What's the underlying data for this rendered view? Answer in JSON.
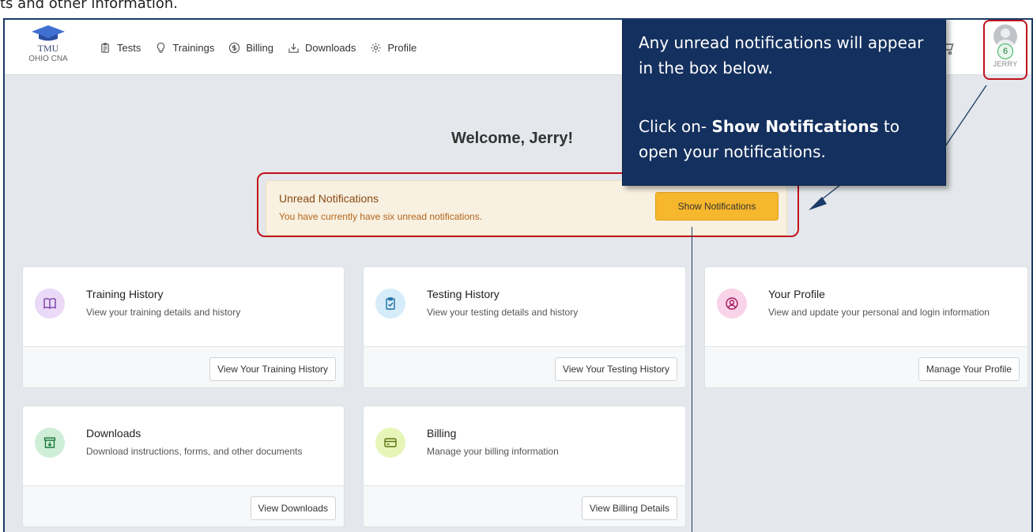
{
  "doc_header": "ts and other information.",
  "app": {
    "logo_line1": "TMU",
    "logo_line2": "OHIO CNA"
  },
  "nav": [
    {
      "label": "Tests",
      "icon": "clipboard-icon"
    },
    {
      "label": "Trainings",
      "icon": "lightbulb-icon"
    },
    {
      "label": "Billing",
      "icon": "dollar-circle-icon"
    },
    {
      "label": "Downloads",
      "icon": "download-tray-icon"
    },
    {
      "label": "Profile",
      "icon": "gear-icon"
    }
  ],
  "user": {
    "badge_count": "6",
    "name": "JERRY"
  },
  "welcome": "Welcome, Jerry!",
  "notifications": {
    "title": "Unread Notifications",
    "text": "You have currently have six unread notifications.",
    "button": "Show Notifications"
  },
  "cards": [
    {
      "title": "Training History",
      "desc": "View your training details and history",
      "button": "View Your Training History",
      "icon": "book-icon",
      "icon_bg": "#ead9f7",
      "icon_color": "#7a3ea6"
    },
    {
      "title": "Testing History",
      "desc": "View your testing details and history",
      "button": "View Your Testing History",
      "icon": "clipboard-check-icon",
      "icon_bg": "#d6ecf9",
      "icon_color": "#1f6fa5"
    },
    {
      "title": "Your Profile",
      "desc": "View and update your personal and login information",
      "button": "Manage Your Profile",
      "icon": "user-circle-icon",
      "icon_bg": "#f9d3e7",
      "icon_color": "#a3195c"
    },
    {
      "title": "Downloads",
      "desc": "Download instructions, forms, and other documents",
      "button": "View Downloads",
      "icon": "archive-download-icon",
      "icon_bg": "#cfeed8",
      "icon_color": "#1c7a3c"
    },
    {
      "title": "Billing",
      "desc": "Manage your billing information",
      "button": "View Billing Details",
      "icon": "credit-card-icon",
      "icon_bg": "#e7f5b8",
      "icon_color": "#5a7310"
    }
  ],
  "callout": {
    "text1": "Any unread notifications will appear in the box below.",
    "text2_prefix": "Click on- ",
    "text2_bold": "Show Notifications",
    "text2_suffix": " to open your notifications."
  },
  "colors": {
    "accent_button": "#f6b72c",
    "callout_bg": "#14305e",
    "highlight_bracket": "#c0121d"
  }
}
